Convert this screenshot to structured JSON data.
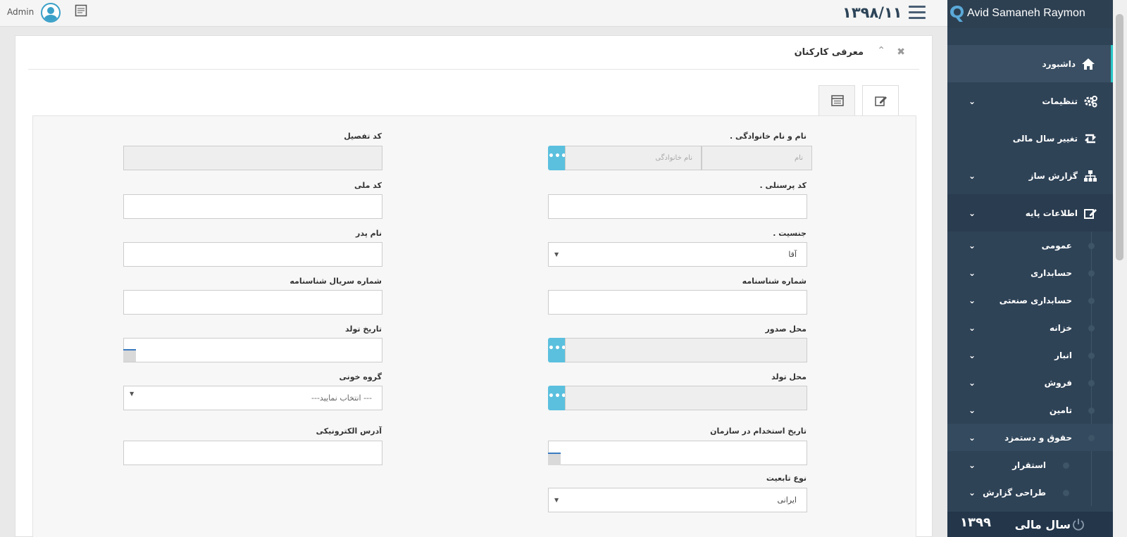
{
  "topbar": {
    "user_label": "Admin",
    "date": "۱۳۹۸/۱۱"
  },
  "sidebar": {
    "brand": "Avid Samaneh Raymon",
    "items": [
      {
        "label": "داشبورد",
        "icon": "home-icon"
      },
      {
        "label": "تنظیمات",
        "icon": "gears-icon"
      },
      {
        "label": "تغییر سال مالی",
        "icon": "retweet-icon"
      },
      {
        "label": "گزارش ساز",
        "icon": "sitemap-icon"
      },
      {
        "label": "اطلاعات پایه",
        "icon": "edit-icon"
      }
    ],
    "subitems": [
      {
        "label": "عمومی"
      },
      {
        "label": "حسابداری"
      },
      {
        "label": "حسابداری صنعتی"
      },
      {
        "label": "خزانه"
      },
      {
        "label": "انبار"
      },
      {
        "label": "فروش"
      },
      {
        "label": "تامین"
      },
      {
        "label": "حقوق و دستمزد"
      },
      {
        "label": "استقرار"
      },
      {
        "label": "طراحی گزارش"
      }
    ],
    "footer": {
      "fiscal_label": "سال مالی",
      "year": "۱۳۹۹"
    },
    "accent": "#29c5c5",
    "bg": "#2f4357"
  },
  "panel": {
    "title": "معرفی کارکنان"
  },
  "form": {
    "full_name_label": "نام و نام خانوادگی .",
    "first_name_placeholder": "نام",
    "last_name_placeholder": "نام خانوادگی",
    "detail_code_label": "کد تفصیل",
    "personnel_code_label": "کد پرسنلی .",
    "national_code_label": "کد ملی",
    "gender_label": "جنسیت .",
    "gender_value": "آقا",
    "father_name_label": "نام پدر",
    "birth_cert_no_label": "شماره شناسنامه",
    "birth_cert_serial_label": "شماره سریال شناسنامه",
    "issue_place_label": "محل صدور",
    "birth_date_label": "تاریخ تولد",
    "birth_place_label": "محل تولد",
    "blood_group_label": "گروه خونی",
    "blood_group_value": "--- انتخاب نمایید---",
    "hire_date_label": "تاریخ استخدام در سازمان",
    "email_label": "آدرس الکترونیکی",
    "nationality_label": "نوع تابعیت",
    "nationality_value": "ایرانی",
    "dots_button": "•••"
  }
}
